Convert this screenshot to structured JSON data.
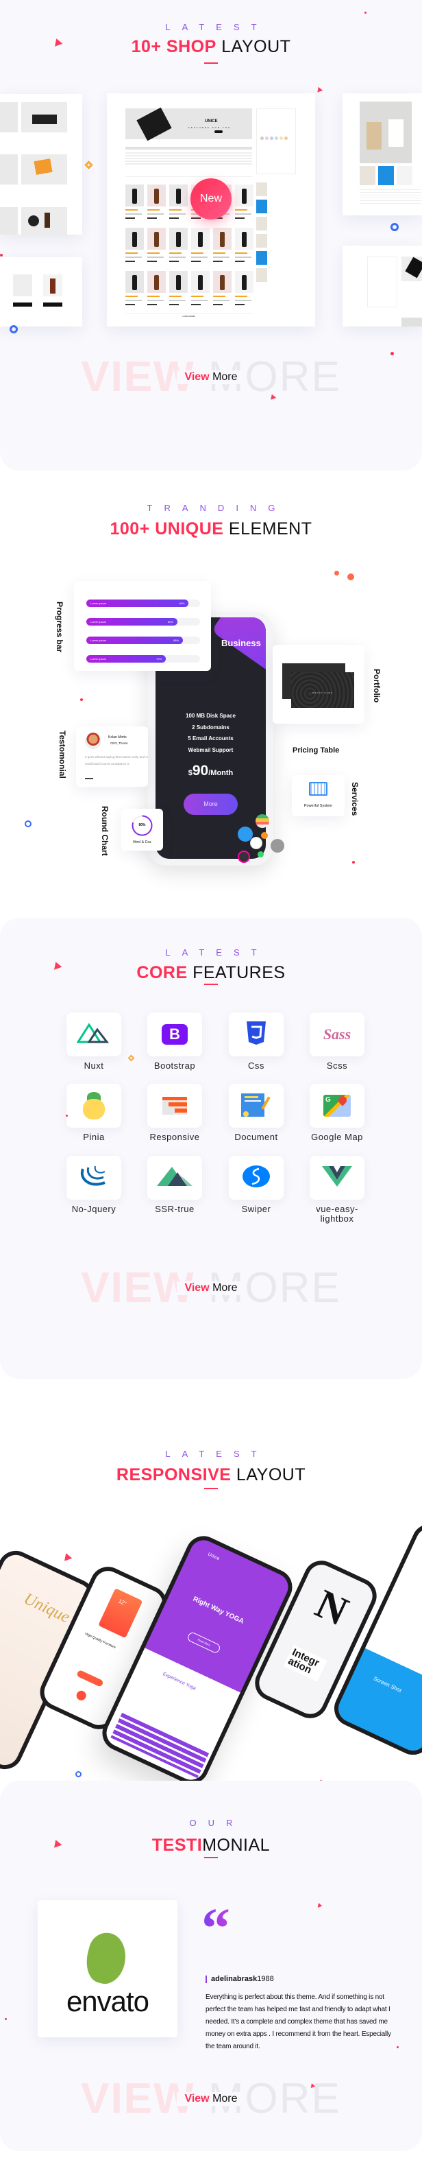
{
  "colors": {
    "accent": "#ff2f55",
    "purple": "#7b3ff0",
    "section_bg": "#f8f8fd",
    "dark": "#23242b"
  },
  "shop": {
    "kicker": "LATEST",
    "title_hi": "10+ SHOP",
    "title_lo": "LAYOUT",
    "banner_brand": "UNICE",
    "banner_sub": "FEATURES FOR YOU",
    "badge": "New",
    "load_more": "LOAD MORE",
    "view_more_bg_a": "VIEW",
    "view_more_bg_b": "MORE",
    "view_more_a": "View",
    "view_more_b": "More"
  },
  "elements": {
    "kicker": "TRANDING",
    "title_hi": "100+ UNIQUE",
    "title_lo": "ELEMENT",
    "labels": {
      "progress": "Progress bar",
      "testimonial": "Testomonial",
      "round": "Round Chart",
      "portfolio": "Portfolio",
      "pricing": "Pricing Table",
      "services": "Services"
    },
    "progress_bars": [
      {
        "label": "Lorem ipsum",
        "value": 90
      },
      {
        "label": "Lorem ipsum",
        "value": 80
      },
      {
        "label": "Lorem ipsum",
        "value": 85
      },
      {
        "label": "Lorem ipsum",
        "value": 70
      }
    ],
    "pricing": {
      "plan": "Business",
      "features": [
        "100 MB Disk Space",
        "2 Subdomains",
        "5 Email Accounts",
        "Webmail Support"
      ],
      "currency": "$",
      "price": "90",
      "period": "/Month",
      "button": "More"
    },
    "testimonial": {
      "name": "Kolan Motto",
      "role": "CEO, Thorat",
      "text": "It goes without saying that custom unity and compliance is top of mind retail board rooms compliance is"
    },
    "round_chart": {
      "value": "80%",
      "label": "Html & Css",
      "percent": 80
    },
    "portfolio": {
      "brand": "BRAND NAME"
    },
    "services": {
      "label": "Powerful System"
    }
  },
  "features": {
    "kicker": "LATEST",
    "title_hi": "CORE",
    "title_lo": "FEATURES",
    "items": [
      {
        "label": "Nuxt",
        "icon": "nuxt-icon"
      },
      {
        "label": "Bootstrap",
        "icon": "bootstrap-icon"
      },
      {
        "label": "Css",
        "icon": "css3-icon"
      },
      {
        "label": "Scss",
        "icon": "sass-icon"
      },
      {
        "label": "Pinia",
        "icon": "pinia-icon"
      },
      {
        "label": "Responsive",
        "icon": "responsive-icon"
      },
      {
        "label": "Document",
        "icon": "document-icon"
      },
      {
        "label": "Google Map",
        "icon": "google-map-icon"
      },
      {
        "label": "No-Jquery",
        "icon": "jquery-icon"
      },
      {
        "label": "SSR-true",
        "icon": "ssr-icon"
      },
      {
        "label": "Swiper",
        "icon": "swiper-icon"
      },
      {
        "label": "vue-easy-lightbox",
        "icon": "vue-icon"
      }
    ],
    "view_more_bg_a": "VIEW",
    "view_more_bg_b": "MORE",
    "view_more_a": "View",
    "view_more_b": "More"
  },
  "responsive": {
    "kicker": "LATEST",
    "title_hi": "RESPONSIVE",
    "title_lo": "LAYOUT",
    "phone_texts": {
      "unique": "Unique",
      "temp": "12°",
      "furniture": "High Quality Furniture",
      "brand": "Unice",
      "hero": "Right Way YOGA",
      "read_more": "Read More",
      "experience": "Experience Yoga",
      "letter": "N",
      "integration": "Integration",
      "screen_shot": "Screen Shot"
    }
  },
  "testimonial": {
    "kicker": "OUR",
    "title_hi": "TESTI",
    "title_lo": "MONIAL",
    "logo_text": "envato",
    "author_bold": "adelinabrask",
    "author_num": "1988",
    "text": "Everything is perfect about this theme. And if something is not perfect the team has helped me fast and friendly to adapt what I needed. It's a complete and complex theme that has saved me money on extra apps . I recommend it from the heart. Especially the team around it.",
    "view_more_bg_a": "VIEW",
    "view_more_bg_b": "MORE",
    "view_more_a": "View",
    "view_more_b": "More"
  }
}
